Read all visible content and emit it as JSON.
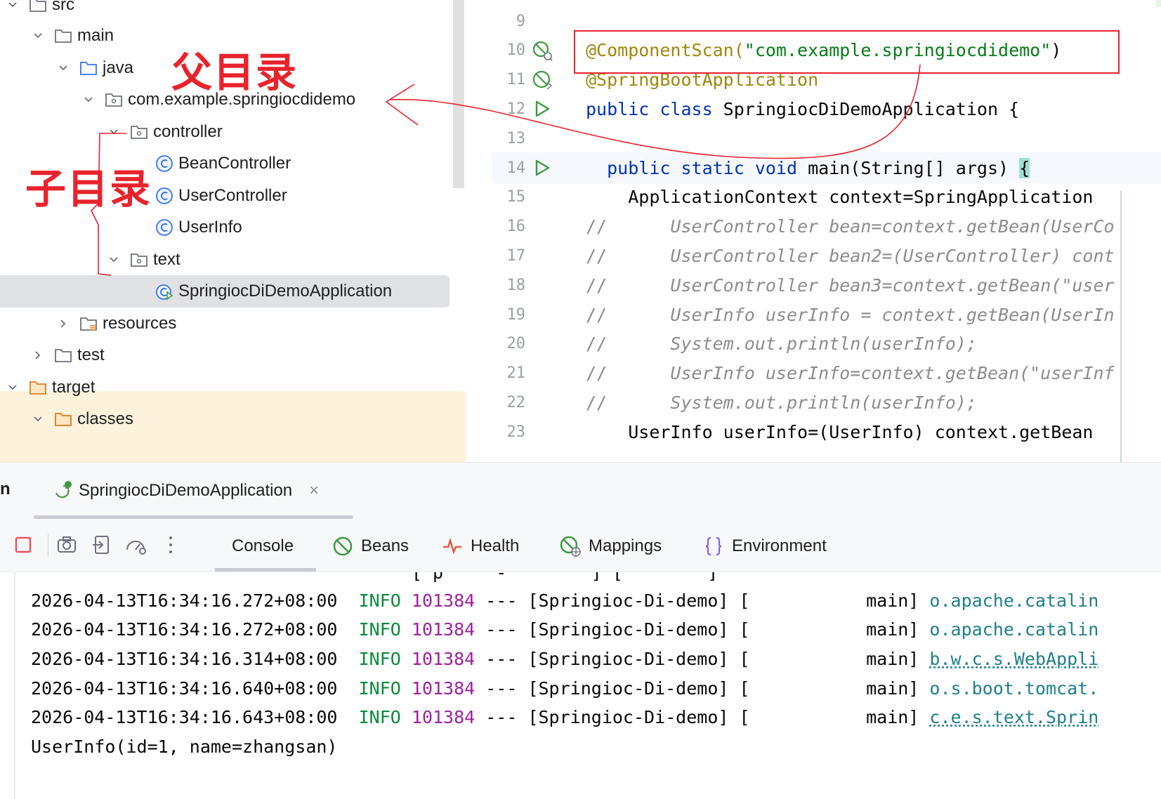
{
  "project_tree": {
    "items": [
      {
        "label": "src",
        "expanded": true,
        "icon": "folder-icon"
      },
      {
        "label": "main",
        "expanded": true,
        "icon": "folder-icon"
      },
      {
        "label": "java",
        "expanded": true,
        "icon": "source-folder-icon"
      },
      {
        "label": "com.example.springiocdidemo",
        "expanded": true,
        "icon": "package-icon"
      },
      {
        "label": "controller",
        "expanded": true,
        "icon": "package-icon"
      },
      {
        "label": "BeanController",
        "icon": "class-icon"
      },
      {
        "label": "UserController",
        "icon": "class-icon"
      },
      {
        "label": "UserInfo",
        "icon": "class-icon"
      },
      {
        "label": "text",
        "expanded": true,
        "icon": "package-icon"
      },
      {
        "label": "SpringiocDiDemoApplication",
        "icon": "spring-boot-class-icon",
        "selected": true
      },
      {
        "label": "resources",
        "expanded": false,
        "icon": "resources-folder-icon"
      },
      {
        "label": "test",
        "expanded": false,
        "icon": "folder-icon"
      },
      {
        "label": "target",
        "expanded": true,
        "icon": "excluded-folder-icon"
      },
      {
        "label": "classes",
        "expanded": true,
        "icon": "excluded-folder-icon"
      }
    ]
  },
  "annotations": {
    "parent_dir": "父目录",
    "sub_dir": "子目录"
  },
  "editor": {
    "lines": [
      {
        "num": "9"
      },
      {
        "num": "10",
        "ann": "@ComponentScan(",
        "str": "\"com.example.springiocdidemo\"",
        "tail": ")"
      },
      {
        "num": "11",
        "ann": "@SpringBootApplication"
      },
      {
        "num": "12",
        "kw": "public class ",
        "tail": "SpringiocDiDemoApplication {"
      },
      {
        "num": "13"
      },
      {
        "num": "14",
        "kw": "public static void ",
        "tail": "main(String[] args) ",
        "brace": "{"
      },
      {
        "num": "15",
        "tail": "ApplicationContext context=SpringApplication"
      },
      {
        "num": "16",
        "slash": "//",
        "cmt": "UserController bean=context.getBean(UserCo"
      },
      {
        "num": "17",
        "slash": "//",
        "cmt": "UserController bean2=(UserController) cont"
      },
      {
        "num": "18",
        "slash": "//",
        "cmt": "UserController bean3=context.getBean(\"user"
      },
      {
        "num": "19",
        "slash": "//",
        "cmt": "UserInfo userInfo = context.getBean(UserIn"
      },
      {
        "num": "20",
        "slash": "//",
        "cmt": "System.out.println(userInfo);"
      },
      {
        "num": "21",
        "slash": "//",
        "cmt": "UserInfo userInfo=context.getBean(\"userInf"
      },
      {
        "num": "22",
        "slash": "//",
        "cmt": "System.out.println(userInfo);"
      },
      {
        "num": "23",
        "tail": "UserInfo userInfo=(UserInfo) context.getBean"
      }
    ]
  },
  "run": {
    "label": "n",
    "tab_label": "SpringiocDiDemoApplication",
    "close_glyph": "×"
  },
  "console_tabs": [
    {
      "label": "Console",
      "icon": "console-tab"
    },
    {
      "label": "Beans",
      "icon": "beans-icon"
    },
    {
      "label": "Health",
      "icon": "health-icon"
    },
    {
      "label": "Mappings",
      "icon": "mappings-icon"
    },
    {
      "label": "Environment",
      "icon": "environment-icon"
    }
  ],
  "console": {
    "lines": [
      {
        "ts": "2026-04-13T16:34:16.272+08:00",
        "level": "INFO",
        "pid": "101384",
        "mid": " --- [Springioc-Di-demo] [           main] ",
        "logger": "o.apache.catalin"
      },
      {
        "ts": "2026-04-13T16:34:16.272+08:00",
        "level": "INFO",
        "pid": "101384",
        "mid": " --- [Springioc-Di-demo] [           main] ",
        "logger": "o.apache.catalin"
      },
      {
        "ts": "2026-04-13T16:34:16.314+08:00",
        "level": "INFO",
        "pid": "101384",
        "mid": " --- [Springioc-Di-demo] [           main] ",
        "logger": "b.w.c.s.WebAppli"
      },
      {
        "ts": "2026-04-13T16:34:16.640+08:00",
        "level": "INFO",
        "pid": "101384",
        "mid": " --- [Springioc-Di-demo] [           main] ",
        "logger": "o.s.boot.tomcat."
      },
      {
        "ts": "2026-04-13T16:34:16.643+08:00",
        "level": "INFO",
        "pid": "101384",
        "mid": " --- [Springioc-Di-demo] [           main] ",
        "logger": "c.e.s.text.Sprin"
      }
    ],
    "output": "UserInfo(id=1, name=zhangsan)"
  },
  "colors": {
    "annotation_red": "#e8232b",
    "keyword": "#0033b3",
    "string": "#067d17",
    "annotation": "#9e880d",
    "info": "#0a8a3a",
    "pid": "#a020a0",
    "logger": "#1f7f8a"
  }
}
